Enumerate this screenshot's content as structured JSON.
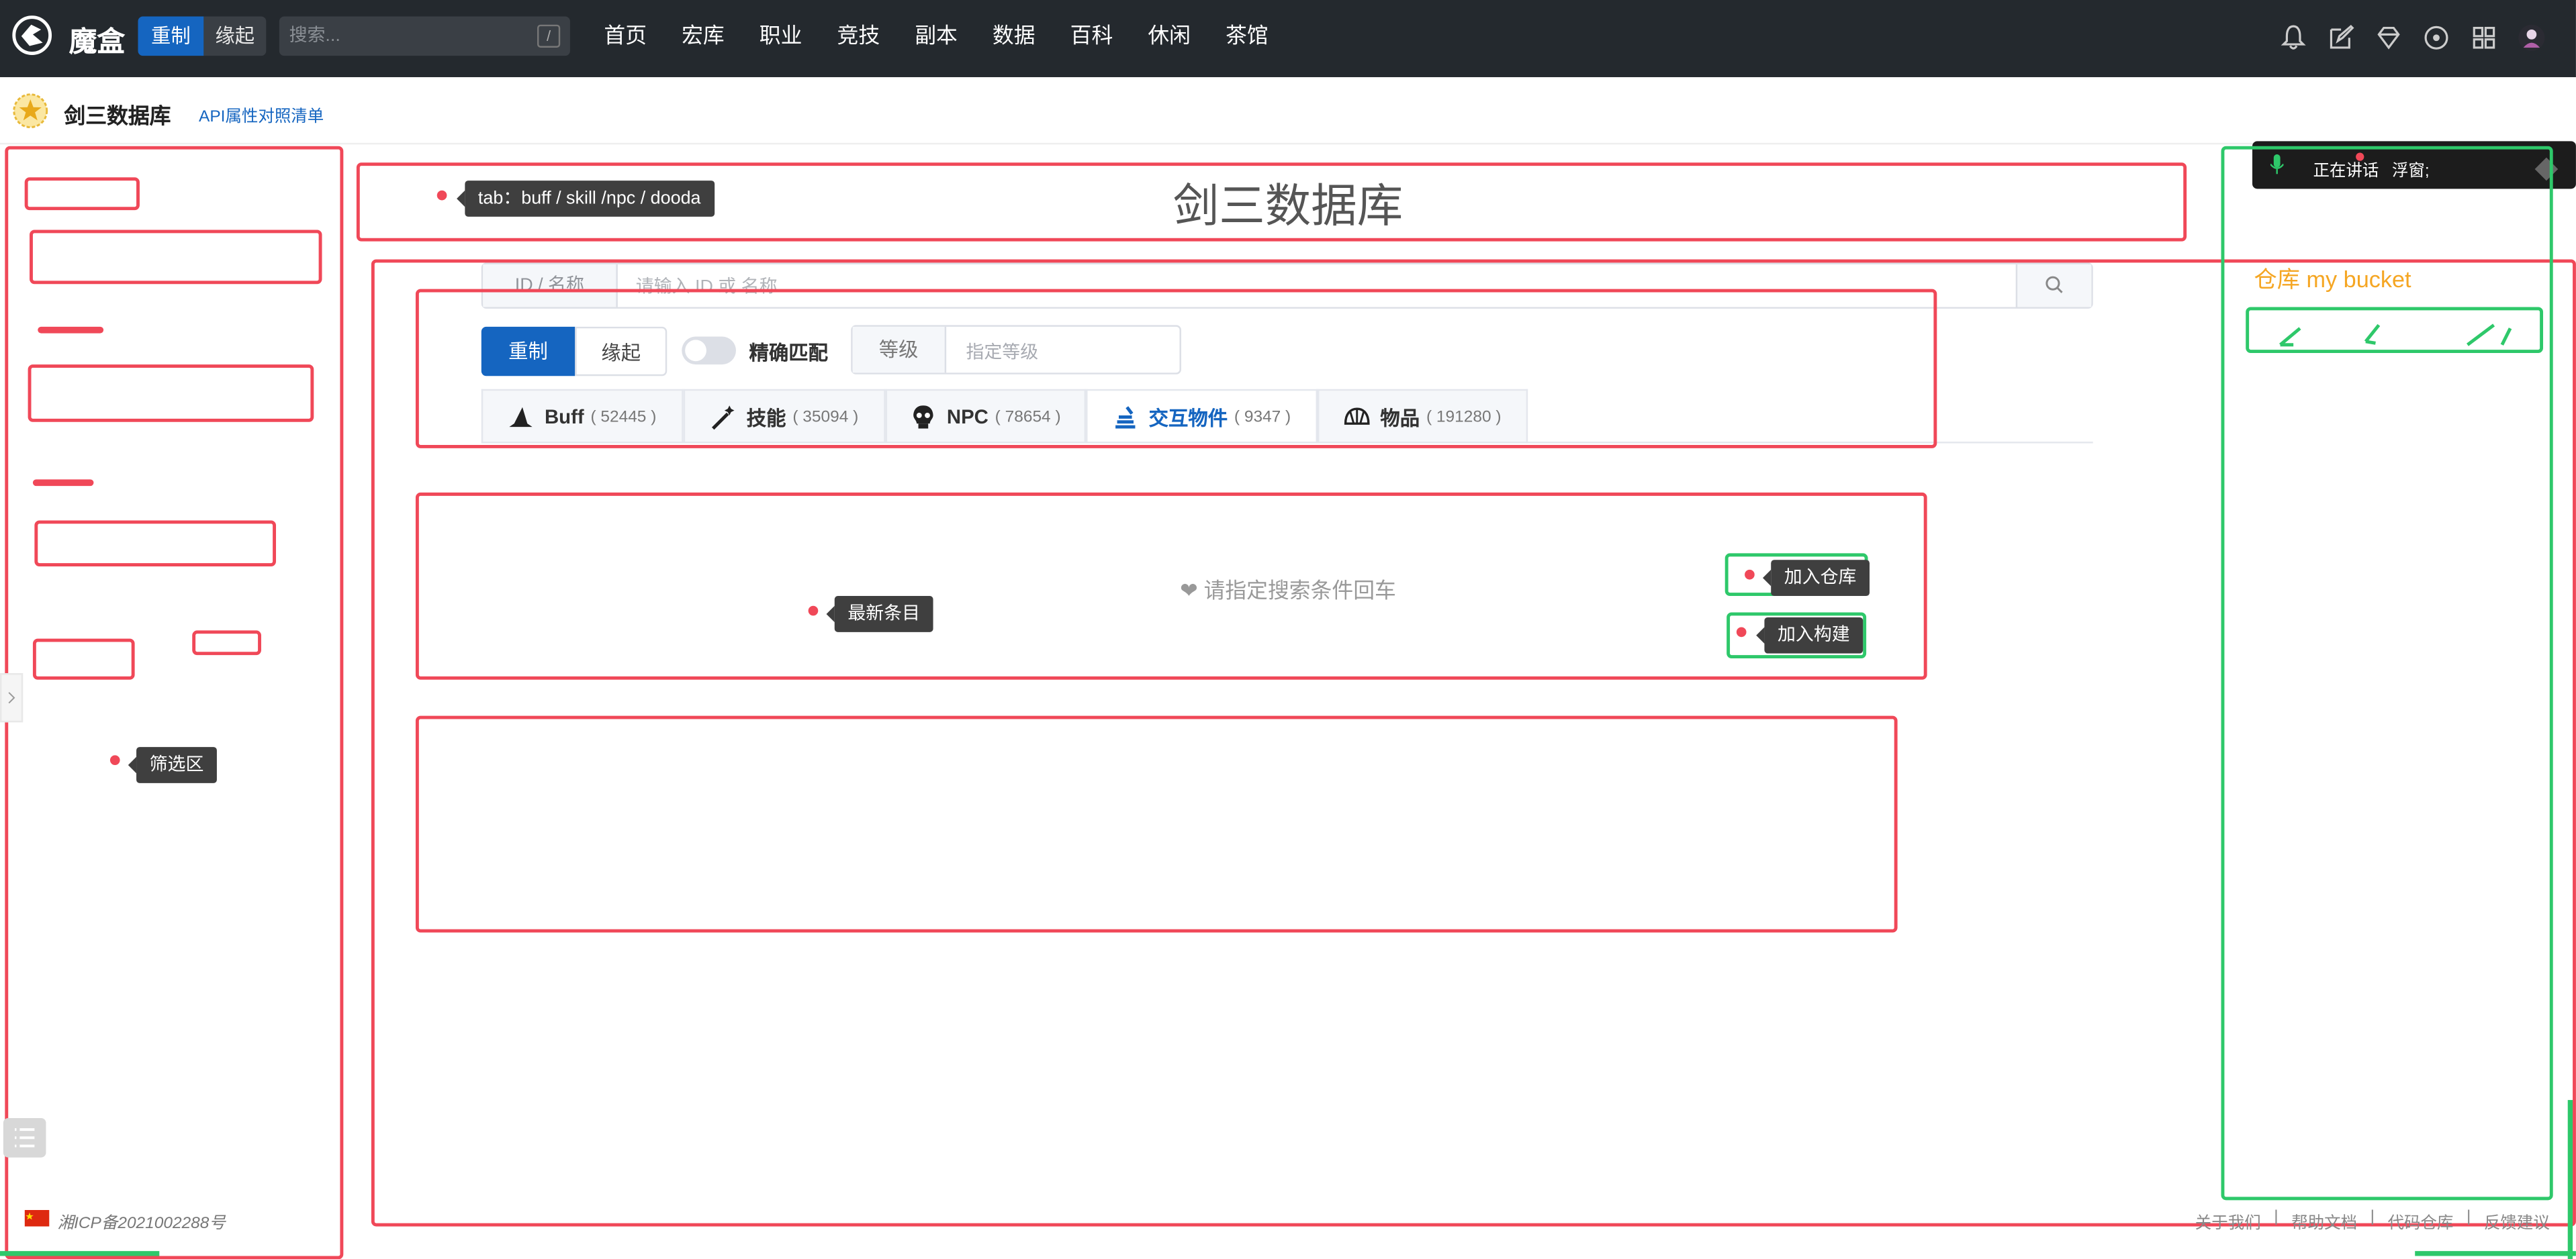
{
  "topbar": {
    "brand": "魔盒",
    "mode_active": "重制",
    "mode_inactive": "缘起",
    "search_placeholder": "搜索...",
    "search_shortcut": "/",
    "nav": [
      "首页",
      "宏库",
      "职业",
      "竞技",
      "副本",
      "数据",
      "百科",
      "休闲",
      "茶馆"
    ],
    "icons": [
      "bell-icon",
      "edit-icon",
      "diamond-icon",
      "circle-dot-icon",
      "grid-icon",
      "user-avatar"
    ]
  },
  "subheader": {
    "title": "剑三数据库",
    "api_link": "API属性对照清单"
  },
  "main": {
    "title": "剑三数据库",
    "search_prefix": "ID  / 名称",
    "search_placeholder": "请输入 ID 或 名称",
    "mode_active": "重制",
    "mode_inactive": "缘起",
    "exact_match": "精确匹配",
    "level_label": "等级",
    "level_placeholder": "指定等级",
    "tabs": [
      {
        "label": "Buff",
        "count": "( 52445 )",
        "icon": "witch-hat-icon",
        "active": false
      },
      {
        "label": "技能",
        "count": "( 35094 )",
        "icon": "magic-wand-icon",
        "active": false
      },
      {
        "label": "NPC",
        "count": "( 78654 )",
        "icon": "skull-icon",
        "active": false
      },
      {
        "label": "交互物件",
        "count": "( 9347 )",
        "icon": "stack-icon",
        "active": true
      },
      {
        "label": "物品",
        "count": "( 191280 )",
        "icon": "shell-icon",
        "active": false
      }
    ],
    "empty_hint": "❤ 请指定搜索条件回车"
  },
  "annotations": {
    "tab_note": "tab：buff / skill /npc / dooda",
    "newest": "最新条目",
    "add_bucket": "加入仓库",
    "add_build": "加入构建",
    "filter_area": "筛选区",
    "bucket_title": "仓库 my bucket"
  },
  "right_panel": {
    "talking": "正在讲话",
    "floating": "浮窗;"
  },
  "footer": {
    "icp": "湘ICP备2021002288号",
    "links": [
      "关于我们",
      "|",
      "帮助文档",
      "|",
      "代码仓库",
      "|",
      "反馈建议"
    ]
  },
  "colors": {
    "annotation_red": "#f04858",
    "annotation_green": "#2ec86a",
    "primary": "#1565c0",
    "bucket_orange": "#f5a623"
  }
}
